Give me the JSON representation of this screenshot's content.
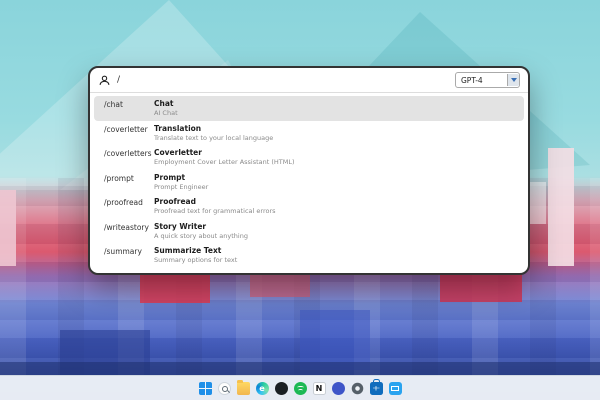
{
  "window": {
    "header": {
      "input": "/",
      "model": "GPT-4"
    },
    "commands": [
      {
        "command": "/chat",
        "title": "Chat",
        "subtitle": "AI Chat",
        "selected": true
      },
      {
        "command": "/coverletter",
        "title": "Translation",
        "subtitle": "Translate text to your local language"
      },
      {
        "command": "/coverletters",
        "title": "Coverletter",
        "subtitle": "Employment Cover Letter Assistant (HTML)"
      },
      {
        "command": "/prompt",
        "title": "Prompt",
        "subtitle": "Prompt Engineer"
      },
      {
        "command": "/proofread",
        "title": "Proofread",
        "subtitle": "Proofread text for grammatical errors"
      },
      {
        "command": "/writeastory",
        "title": "Story Writer",
        "subtitle": "A quick story about anything"
      },
      {
        "command": "/summary",
        "title": "Summarize Text",
        "subtitle": "Summary options for text"
      }
    ]
  },
  "taskbar": {
    "icons": [
      {
        "name": "start"
      },
      {
        "name": "search"
      },
      {
        "name": "file-explorer"
      },
      {
        "name": "edge",
        "glyph": "e"
      },
      {
        "name": "github"
      },
      {
        "name": "spotify"
      },
      {
        "name": "notion",
        "glyph": "N"
      },
      {
        "name": "discord"
      },
      {
        "name": "settings"
      },
      {
        "name": "store"
      },
      {
        "name": "mail"
      }
    ]
  },
  "colors": {
    "selected_row": "#e3e3e3",
    "window_border": "#333333",
    "taskbar_bg": "#f3f6fa",
    "wallpaper_sky": "#8ad4db",
    "wallpaper_pink": "#d94f66",
    "wallpaper_blue": "#2f479f"
  }
}
